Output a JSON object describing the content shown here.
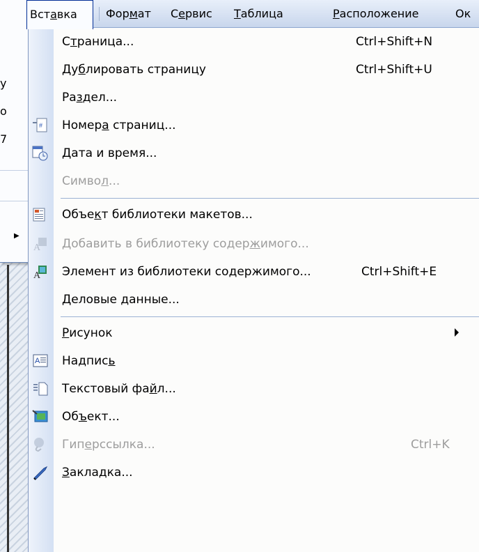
{
  "menubar": {
    "items": [
      {
        "label": "Вставка",
        "underline": "а"
      },
      {
        "label": "Формат",
        "underline": "м"
      },
      {
        "label": "Сервис",
        "underline": "е"
      },
      {
        "label": "Таблица",
        "underline": "Т"
      },
      {
        "label": "Расположение",
        "underline": "Р"
      },
      {
        "label": "Ок"
      }
    ]
  },
  "left_panel": {
    "chars": [
      "y",
      "o",
      "7"
    ]
  },
  "menu": {
    "items": [
      {
        "pre": "С",
        "u": "т",
        "post": "раница...",
        "shortcut": "Ctrl+Shift+N",
        "icon": "",
        "disabled": false
      },
      {
        "pre": "Ду",
        "u": "б",
        "post": "лировать страницу",
        "shortcut": "Ctrl+Shift+U",
        "icon": "",
        "disabled": false
      },
      {
        "pre": "Ра",
        "u": "з",
        "post": "дел...",
        "shortcut": "",
        "icon": "",
        "disabled": false
      },
      {
        "pre": "Номер",
        "u": "а",
        "post": " страниц...",
        "shortcut": "",
        "icon": "page-numbers-icon",
        "disabled": false
      },
      {
        "pre": "",
        "u": "Д",
        "post": "ата и время...",
        "shortcut": "",
        "icon": "date-time-icon",
        "disabled": false
      },
      {
        "pre": "Симво",
        "u": "л",
        "post": "...",
        "shortcut": "",
        "icon": "",
        "disabled": true
      },
      {
        "pre": "Объе",
        "u": "к",
        "post": "т библиотеки макетов...",
        "shortcut": "",
        "icon": "design-gallery-icon",
        "disabled": false
      },
      {
        "pre": "Добавить в библиотеку содер",
        "u": "ж",
        "post": "имого...",
        "shortcut": "",
        "icon": "add-to-content-library-icon",
        "disabled": true
      },
      {
        "pre": "Элемент из библиотеки со",
        "u": "д",
        "post": "ержимого...",
        "shortcut": "Ctrl+Shift+E",
        "icon": "content-library-item-icon",
        "disabled": false
      },
      {
        "pre": "Деловые ",
        "u": "д",
        "post": "анные...",
        "shortcut": "",
        "icon": "",
        "disabled": false
      },
      {
        "pre": "",
        "u": "Р",
        "post": "исунок",
        "shortcut": "",
        "icon": "",
        "disabled": false,
        "submenu": true
      },
      {
        "pre": "Надпис",
        "u": "ь",
        "post": "",
        "shortcut": "",
        "icon": "text-box-icon",
        "disabled": false
      },
      {
        "pre": "Текстовый фа",
        "u": "й",
        "post": "л...",
        "shortcut": "",
        "icon": "text-file-icon",
        "disabled": false
      },
      {
        "pre": "Об",
        "u": "ъ",
        "post": "ект...",
        "shortcut": "",
        "icon": "object-icon",
        "disabled": false
      },
      {
        "pre": "Гип",
        "u": "е",
        "post": "рссылка...",
        "shortcut": "Ctrl+K",
        "icon": "hyperlink-icon",
        "disabled": true
      },
      {
        "pre": "",
        "u": "З",
        "post": "акладка...",
        "shortcut": "",
        "icon": "bookmark-icon",
        "disabled": false
      }
    ]
  }
}
